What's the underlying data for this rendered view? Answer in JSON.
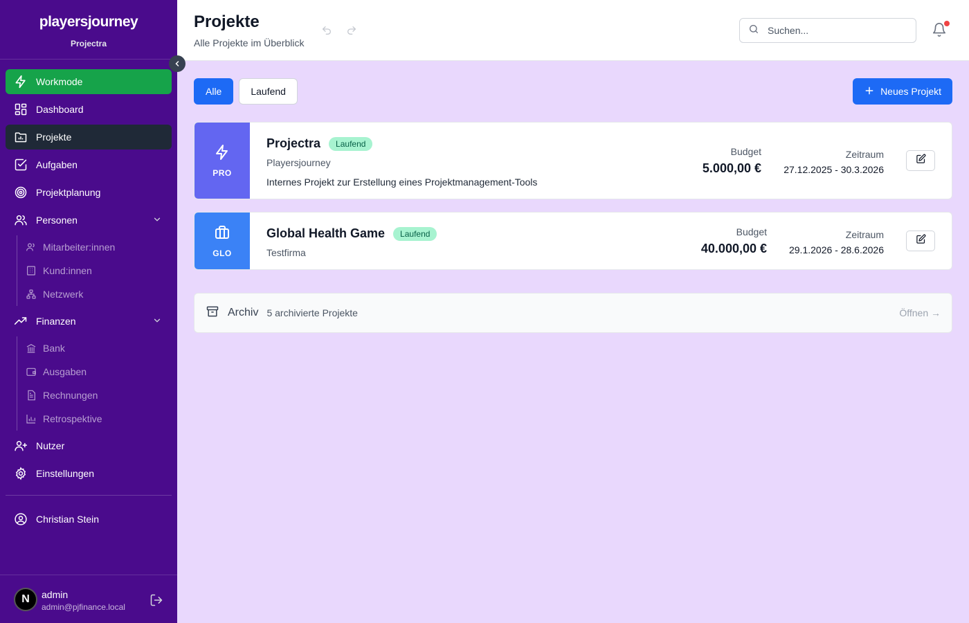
{
  "sidebar": {
    "logo": "playersjourney",
    "app_name": "Projectra",
    "items": {
      "workmode": "Workmode",
      "dashboard": "Dashboard",
      "projekte": "Projekte",
      "aufgaben": "Aufgaben",
      "projektplanung": "Projektplanung",
      "personen": "Personen",
      "finanzen": "Finanzen",
      "nutzer": "Nutzer",
      "einstellungen": "Einstellungen"
    },
    "personen_sub": [
      "Mitarbeiter:innen",
      "Kund:innen",
      "Netzwerk"
    ],
    "finanzen_sub": [
      "Bank",
      "Ausgaben",
      "Rechnungen",
      "Retrospektive"
    ],
    "current_user": "Christian Stein",
    "account": {
      "avatar_letter": "N",
      "name": "admin",
      "email": "admin@pjfinance.local"
    }
  },
  "header": {
    "title": "Projekte",
    "subtitle": "Alle Projekte im Überblick",
    "search_placeholder": "Suchen..."
  },
  "filters": [
    "Alle",
    "Laufend"
  ],
  "new_project_label": "Neues Projekt",
  "projects": [
    {
      "code": "PRO",
      "name": "Projectra",
      "status": "Laufend",
      "client": "Playersjourney",
      "description": "Internes Projekt zur Erstellung eines Projektmanagement-Tools",
      "budget_label": "Budget",
      "budget": "5.000,00 €",
      "period_label": "Zeitraum",
      "period": "27.12.2025 - 30.3.2026",
      "color": "#6366f1"
    },
    {
      "code": "GLO",
      "name": "Global Health Game",
      "status": "Laufend",
      "client": "Testfirma",
      "description": "",
      "budget_label": "Budget",
      "budget": "40.000,00 €",
      "period_label": "Zeitraum",
      "period": "29.1.2026 - 28.6.2026",
      "color": "#3b82f6"
    }
  ],
  "archive": {
    "title": "Archiv",
    "count": "5 archivierte Projekte",
    "open_label": "Öffnen →"
  },
  "colors": {
    "sidebar_bg": "#4a0b8c",
    "accent_blue": "#1d6af5",
    "workmode_green": "#16a34a",
    "content_bg": "#e9d8fd"
  }
}
